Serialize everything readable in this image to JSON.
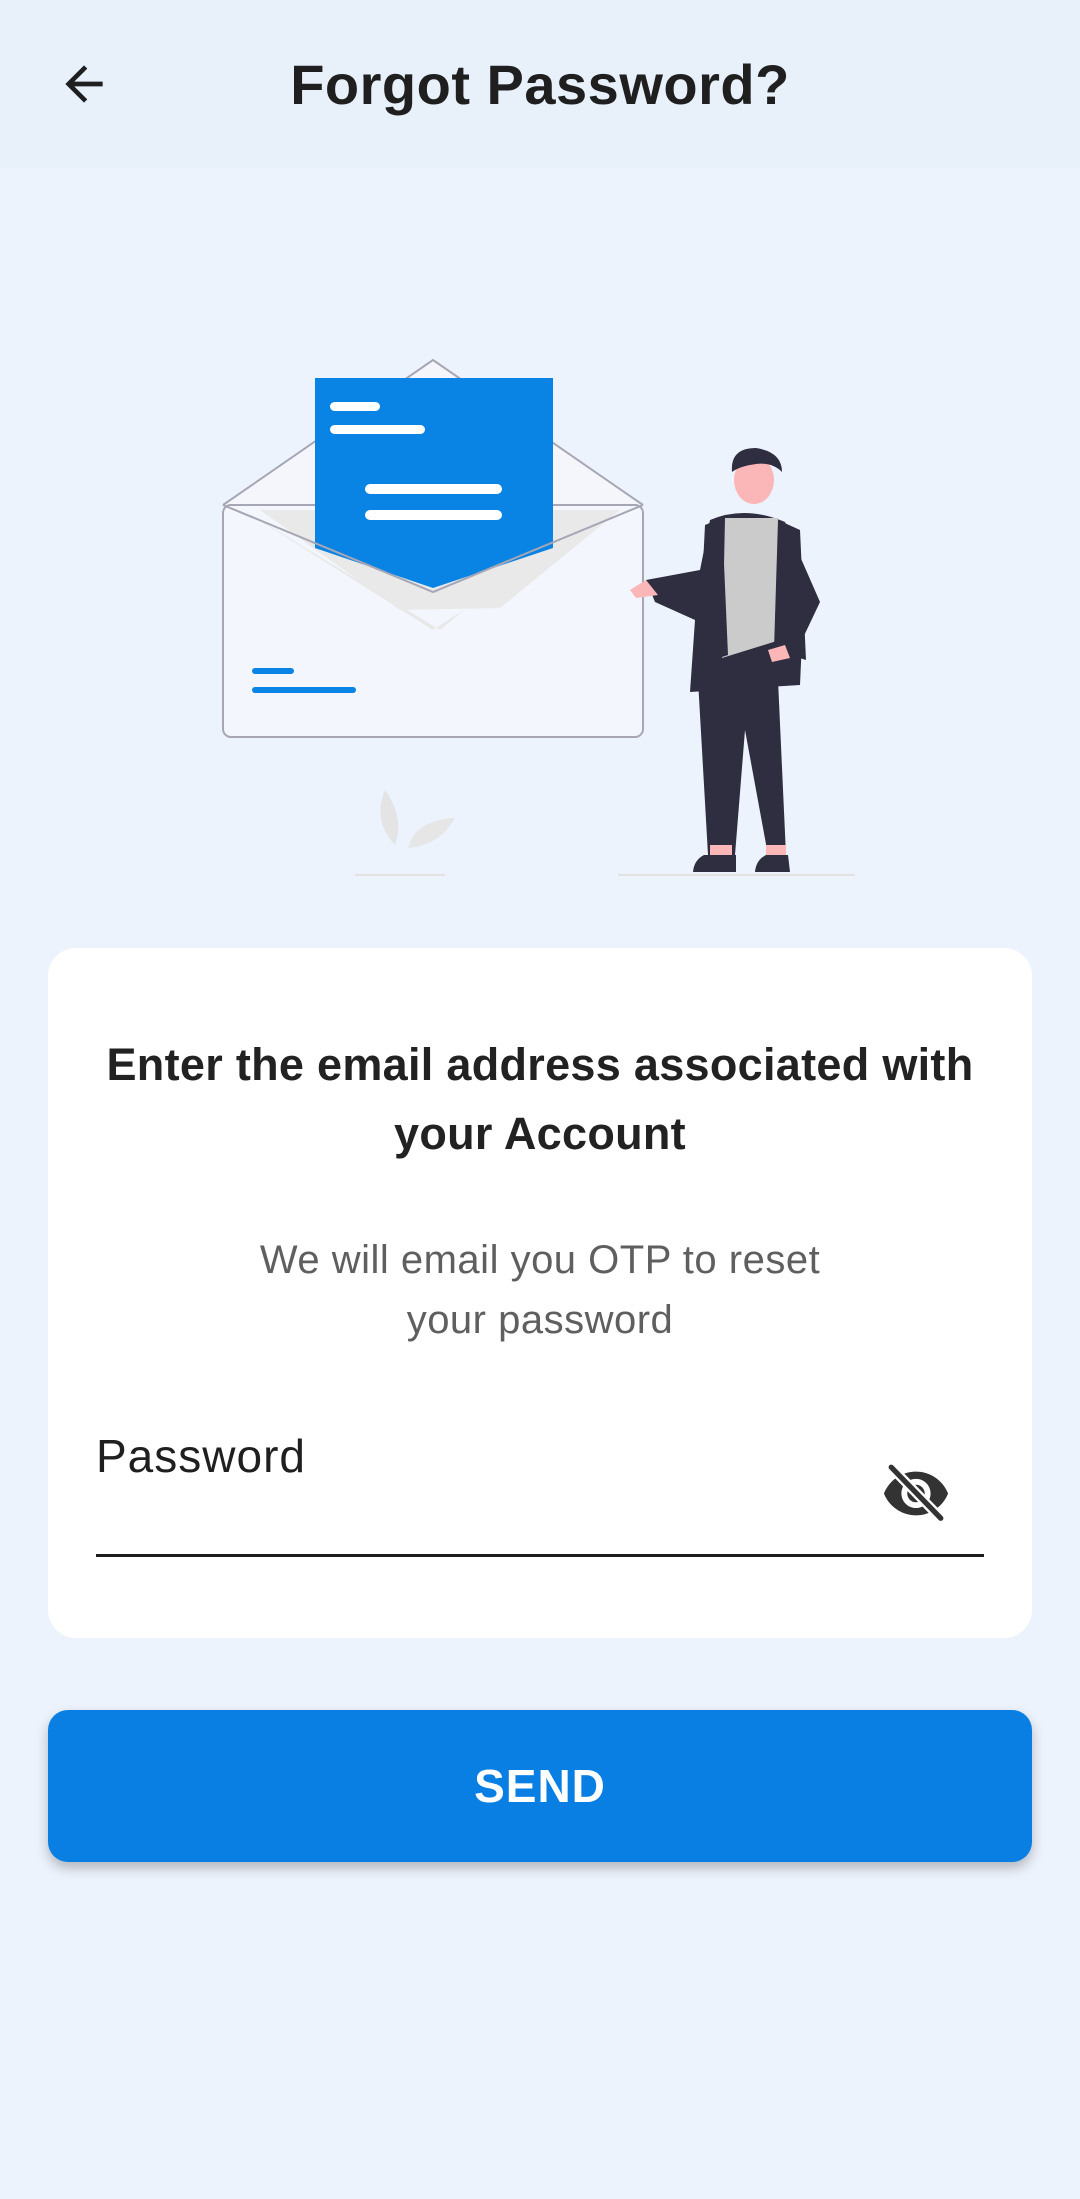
{
  "appbar": {
    "title": "Forgot Password?",
    "back_icon": "arrow-left-icon"
  },
  "illustration": {
    "icon": "envelope-with-person-illustration"
  },
  "card": {
    "heading": "Enter the email address associated with your Account",
    "subtitle": "We will email you OTP to reset your password",
    "field": {
      "label": "Password",
      "visibility_icon": "eye-off-icon"
    }
  },
  "send_button": {
    "label": "SEND"
  },
  "colors": {
    "background": "#edf3fc",
    "appbar": "#e8f0fa",
    "primary": "#0a7fe3",
    "card": "#ffffff",
    "text_dark": "#222222",
    "text_muted": "#5f5f5f"
  }
}
